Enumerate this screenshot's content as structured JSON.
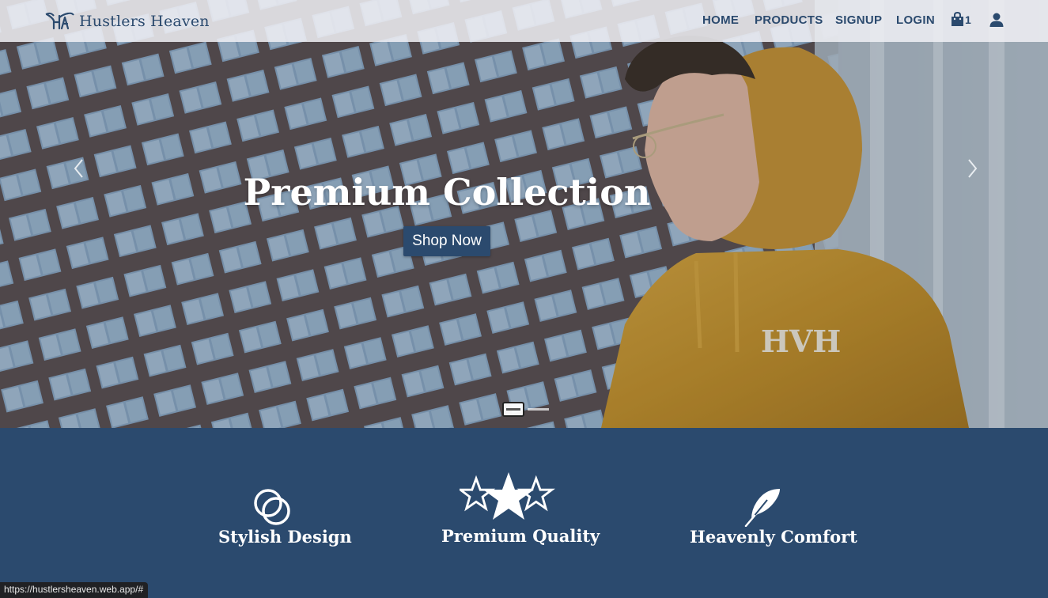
{
  "navbar": {
    "brand": "Hustlers Heaven",
    "links": [
      "HOME",
      "PRODUCTS",
      "SIGNUP",
      "LOGIN"
    ],
    "cart_count": "1",
    "icons": [
      "logo-icon",
      "shopping-bag-icon",
      "user-icon"
    ]
  },
  "hero": {
    "title": "Premium Collection",
    "button": "Shop Now",
    "slides": 2,
    "active_slide": 1,
    "icons": [
      "chevron-left-icon",
      "chevron-right-icon"
    ]
  },
  "features": [
    {
      "label": "Stylish Design",
      "icon": "overlapping-circles-icon"
    },
    {
      "label": "Premium Quality",
      "icon": "stars-icon"
    },
    {
      "label": "Heavenly Comfort",
      "icon": "feather-icon"
    }
  ],
  "status_url": "https://hustlersheaven.web.app/#",
  "colors": {
    "primary": "#2b4a6e",
    "accent": "#e0a22a",
    "white": "#ffffff"
  }
}
